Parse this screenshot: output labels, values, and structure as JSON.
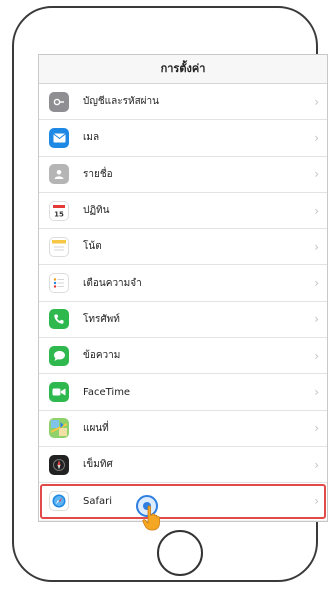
{
  "screen": {
    "title": "การตั้งค่า"
  },
  "settings": {
    "items": [
      {
        "label": "บัญชีและรหัสผ่าน",
        "icon": "key-icon",
        "color": "#8e8e93"
      },
      {
        "label": "เมล",
        "icon": "mail-icon",
        "color": "#1e88e5"
      },
      {
        "label": "รายชื่อ",
        "icon": "contacts-icon",
        "color": "#9e9e9e"
      },
      {
        "label": "ปฏิทิน",
        "icon": "calendar-icon",
        "color": "#ffffff"
      },
      {
        "label": "โน้ต",
        "icon": "notes-icon",
        "color": "#ffffff"
      },
      {
        "label": "เตือนความจำ",
        "icon": "reminders-icon",
        "color": "#ffffff"
      },
      {
        "label": "โทรศัพท์",
        "icon": "phone-icon",
        "color": "#2eb84d"
      },
      {
        "label": "ข้อความ",
        "icon": "messages-icon",
        "color": "#2eb84d"
      },
      {
        "label": "FaceTime",
        "icon": "facetime-icon",
        "color": "#2eb84d"
      },
      {
        "label": "แผนที่",
        "icon": "maps-icon",
        "color": "#7fc3e8"
      },
      {
        "label": "เข็มทิศ",
        "icon": "compass-icon",
        "color": "#222222"
      },
      {
        "label": "Safari",
        "icon": "safari-icon",
        "color": "#1e88e5"
      }
    ]
  },
  "highlight_color": "#e24a4a"
}
